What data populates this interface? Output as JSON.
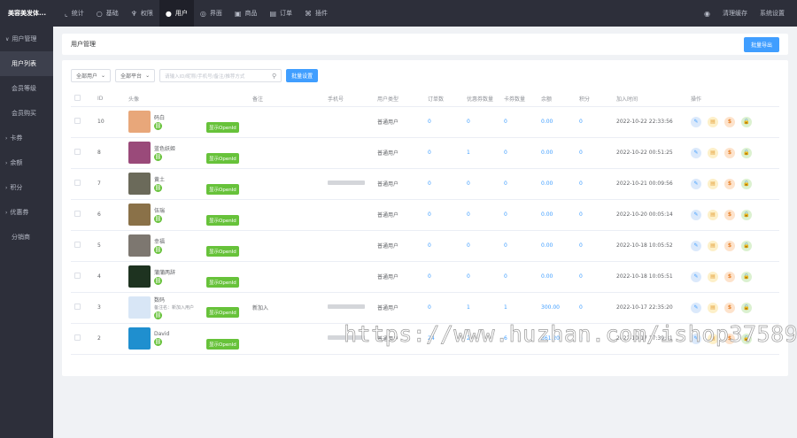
{
  "app": {
    "name": "美容美发体..."
  },
  "topnav": [
    {
      "label": "统计",
      "icon": "chart-icon",
      "glyph": "⌞"
    },
    {
      "label": "基础",
      "icon": "circle-icon",
      "glyph": "○"
    },
    {
      "label": "权限",
      "icon": "hierarchy-icon",
      "glyph": "♆"
    },
    {
      "label": "用户",
      "icon": "user-icon",
      "glyph": "●"
    },
    {
      "label": "界面",
      "icon": "palette-icon",
      "glyph": "◎"
    },
    {
      "label": "商品",
      "icon": "box-icon",
      "glyph": "▣"
    },
    {
      "label": "订单",
      "icon": "order-icon",
      "glyph": "▤"
    },
    {
      "label": "插件",
      "icon": "plugin-icon",
      "glyph": "⌘"
    }
  ],
  "topright": {
    "clear_cache": "清理缓存",
    "settings": "系统设置"
  },
  "sidebar": [
    {
      "label": "用户管理",
      "type": "group",
      "expanded": true
    },
    {
      "label": "用户列表",
      "type": "sub",
      "active": true
    },
    {
      "label": "会员等级",
      "type": "sub"
    },
    {
      "label": "会员购买",
      "type": "sub"
    },
    {
      "label": "卡券",
      "type": "group"
    },
    {
      "label": "余额",
      "type": "group"
    },
    {
      "label": "积分",
      "type": "group"
    },
    {
      "label": "优惠券",
      "type": "group"
    },
    {
      "label": "分销商",
      "type": "plain"
    }
  ],
  "page": {
    "title": "用户管理",
    "export_button": "批量导出"
  },
  "filters": {
    "user_type": "全部用户",
    "platform": "全部平台",
    "search_placeholder": "请输入ID/昵称/手机号/备注/推荐方式",
    "search_button": "批量设置"
  },
  "columns": [
    "ID",
    "头像",
    "备注",
    "手机号",
    "用户类型",
    "订单数",
    "优惠券数量",
    "卡券数量",
    "余额",
    "积分",
    "加入时间",
    "操作"
  ],
  "openid_label": "显示OpenId",
  "users": [
    {
      "id": "10",
      "name": "码白",
      "sub": "",
      "note": "",
      "phone": "",
      "type": "普通用户",
      "orders": "0",
      "coupons": "0",
      "cards": "0",
      "balance": "0.00",
      "points": "0",
      "joined": "2022-10-22 22:33:56",
      "avatar": "#e8a77a"
    },
    {
      "id": "8",
      "name": "蓝色妖姬",
      "sub": "",
      "note": "",
      "phone": "",
      "type": "普通用户",
      "orders": "0",
      "coupons": "1",
      "cards": "0",
      "balance": "0.00",
      "points": "0",
      "joined": "2022-10-22 00:51:25",
      "avatar": "#9a4a7a"
    },
    {
      "id": "7",
      "name": "黄土",
      "sub": "",
      "note": "",
      "phone": "masked",
      "type": "普通用户",
      "orders": "0",
      "coupons": "0",
      "cards": "0",
      "balance": "0.00",
      "points": "0",
      "joined": "2022-10-21 00:09:56",
      "avatar": "#6b6a5a"
    },
    {
      "id": "6",
      "name": "伍瑞",
      "sub": "",
      "note": "",
      "phone": "",
      "type": "普通用户",
      "orders": "0",
      "coupons": "0",
      "cards": "0",
      "balance": "0.00",
      "points": "0",
      "joined": "2022-10-20 00:05:14",
      "avatar": "#8a7148"
    },
    {
      "id": "5",
      "name": "幸福",
      "sub": "",
      "note": "",
      "phone": "",
      "type": "普通用户",
      "orders": "0",
      "coupons": "0",
      "cards": "0",
      "balance": "0.00",
      "points": "0",
      "joined": "2022-10-18 10:05:52",
      "avatar": "#7d7770"
    },
    {
      "id": "4",
      "name": "蒲蒲两辞",
      "sub": "",
      "note": "",
      "phone": "",
      "type": "普通用户",
      "orders": "0",
      "coupons": "0",
      "cards": "0",
      "balance": "0.00",
      "points": "0",
      "joined": "2022-10-18 10:05:51",
      "avatar": "#1e3320"
    },
    {
      "id": "3",
      "name": "数码",
      "sub": "备注名：新加入用户",
      "note": "新加入",
      "phone": "masked",
      "type": "普通用户",
      "orders": "0",
      "coupons": "1",
      "cards": "1",
      "balance": "300.00",
      "points": "0",
      "joined": "2022-10-17 22:35:20",
      "avatar": "#d8e6f6"
    },
    {
      "id": "2",
      "name": "David",
      "sub": "",
      "note": "",
      "phone": "masked",
      "type": "普通用户",
      "orders": "24",
      "coupons": "2",
      "cards": "6",
      "balance": "361.20",
      "points": "6",
      "joined": "2022-10-17 17:39:31",
      "avatar": "#1f8fcf"
    }
  ],
  "watermark": "https://www.huzhan.com/ishop37589"
}
